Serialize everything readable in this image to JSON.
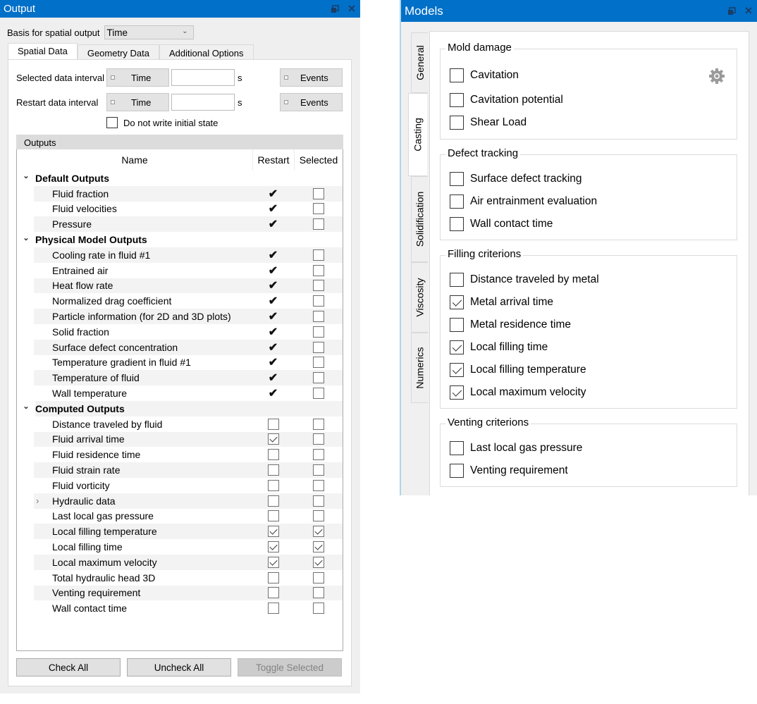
{
  "output_panel": {
    "title": "Output",
    "float_icon": "restore-window-icon",
    "close_icon": "close-icon",
    "basis_label": "Basis for spatial output",
    "basis_value": "Time",
    "tabs": [
      {
        "label": "Spatial Data",
        "active": true
      },
      {
        "label": "Geometry Data",
        "active": false
      },
      {
        "label": "Additional Options",
        "active": false
      }
    ],
    "selected_interval": {
      "label": "Selected data interval",
      "time_label": "Time",
      "value": "",
      "unit": "s",
      "events_label": "Events"
    },
    "restart_interval": {
      "label": "Restart data interval",
      "time_label": "Time",
      "value": "",
      "unit": "s",
      "events_label": "Events"
    },
    "no_initial_state": {
      "label": "Do not write initial state",
      "checked": false
    },
    "outputs_header": "Outputs",
    "columns": {
      "name": "Name",
      "restart": "Restart",
      "selected": "Selected"
    },
    "groups": [
      {
        "label": "Default Outputs",
        "expanded": true,
        "items": [
          {
            "name": "Fluid fraction",
            "restart": "fixed",
            "selected": false
          },
          {
            "name": "Fluid velocities",
            "restart": "fixed",
            "selected": false
          },
          {
            "name": "Pressure",
            "restart": "fixed",
            "selected": false
          }
        ]
      },
      {
        "label": "Physical Model Outputs",
        "expanded": true,
        "items": [
          {
            "name": "Cooling rate in fluid #1",
            "restart": "fixed",
            "selected": false
          },
          {
            "name": "Entrained air",
            "restart": "fixed",
            "selected": false
          },
          {
            "name": "Heat flow rate",
            "restart": "fixed",
            "selected": false
          },
          {
            "name": "Normalized drag coefficient",
            "restart": "fixed",
            "selected": false
          },
          {
            "name": "Particle information (for 2D and 3D plots)",
            "restart": "fixed",
            "selected": false
          },
          {
            "name": "Solid fraction",
            "restart": "fixed",
            "selected": false
          },
          {
            "name": "Surface defect concentration",
            "restart": "fixed",
            "selected": false
          },
          {
            "name": "Temperature gradient in fluid #1",
            "restart": "fixed",
            "selected": false
          },
          {
            "name": "Temperature of fluid",
            "restart": "fixed",
            "selected": false
          },
          {
            "name": "Wall temperature",
            "restart": "fixed",
            "selected": false
          }
        ]
      },
      {
        "label": "Computed Outputs",
        "expanded": true,
        "items": [
          {
            "name": "Distance traveled by fluid",
            "restart": false,
            "selected": false
          },
          {
            "name": "Fluid arrival time",
            "restart": true,
            "selected": false
          },
          {
            "name": "Fluid residence time",
            "restart": false,
            "selected": false
          },
          {
            "name": "Fluid strain rate",
            "restart": false,
            "selected": false
          },
          {
            "name": "Fluid vorticity",
            "restart": false,
            "selected": false
          },
          {
            "name": "Hydraulic data",
            "restart": false,
            "selected": false,
            "expandable": true
          },
          {
            "name": "Last local gas pressure",
            "restart": false,
            "selected": false
          },
          {
            "name": "Local filling temperature",
            "restart": true,
            "selected": true
          },
          {
            "name": "Local filling time",
            "restart": true,
            "selected": true
          },
          {
            "name": "Local maximum velocity",
            "restart": true,
            "selected": true
          },
          {
            "name": "Total hydraulic head 3D",
            "restart": false,
            "selected": false
          },
          {
            "name": "Venting requirement",
            "restart": false,
            "selected": false
          },
          {
            "name": "Wall contact time",
            "restart": false,
            "selected": false
          }
        ]
      }
    ],
    "buttons": {
      "check_all": "Check All",
      "uncheck_all": "Uncheck All",
      "toggle_selected": "Toggle Selected"
    }
  },
  "models_panel": {
    "title": "Models",
    "vertical_tabs": [
      {
        "label": "General",
        "active": false
      },
      {
        "label": "Casting",
        "active": true
      },
      {
        "label": "Solidification",
        "active": false
      },
      {
        "label": "Viscosity",
        "active": false
      },
      {
        "label": "Numerics",
        "active": false
      }
    ],
    "groups": [
      {
        "legend": "Mold damage",
        "options": [
          {
            "label": "Cavitation",
            "checked": false,
            "settings_icon": "gear-icon"
          },
          {
            "label": "Cavitation potential",
            "checked": false
          },
          {
            "label": "Shear Load",
            "checked": false
          }
        ]
      },
      {
        "legend": "Defect tracking",
        "options": [
          {
            "label": "Surface defect tracking",
            "checked": false
          },
          {
            "label": "Air entrainment evaluation",
            "checked": false
          },
          {
            "label": "Wall contact time",
            "checked": false
          }
        ]
      },
      {
        "legend": "Filling criterions",
        "options": [
          {
            "label": "Distance traveled by metal",
            "checked": false
          },
          {
            "label": "Metal arrival time",
            "checked": true
          },
          {
            "label": "Metal residence time",
            "checked": false
          },
          {
            "label": "Local filling time",
            "checked": true
          },
          {
            "label": "Local filling temperature",
            "checked": true
          },
          {
            "label": "Local maximum velocity",
            "checked": true
          }
        ]
      },
      {
        "legend": "Venting criterions",
        "options": [
          {
            "label": "Last local gas pressure",
            "checked": false
          },
          {
            "label": "Venting requirement",
            "checked": false
          }
        ]
      }
    ]
  },
  "colors": {
    "titlebar": "#0070c8",
    "panel_bg": "#efefef"
  }
}
